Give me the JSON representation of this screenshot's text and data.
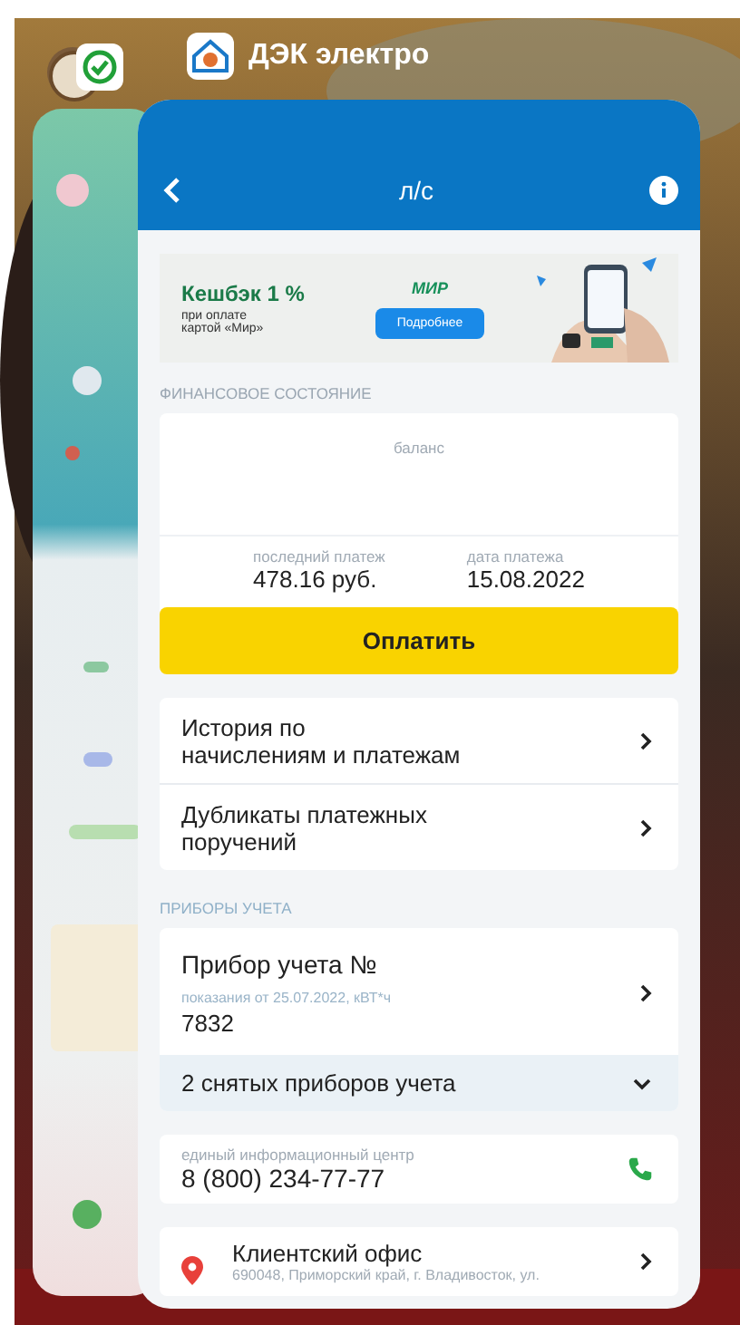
{
  "switcher": {
    "app_label": "ДЭК электро"
  },
  "app": {
    "nav": {
      "title": "л/с"
    },
    "banner": {
      "headline": "Кешбэк 1 %",
      "subtext": "при оплате\nкартой «Мир»",
      "logo_text": "МИР",
      "button": "Подробнее"
    },
    "finance": {
      "section_title": "ФИНАНСОВОЕ СОСТОЯНИЕ",
      "balance_label": "баланс",
      "last_payment_label": "последний платеж",
      "last_payment": "478.16 руб.",
      "date_label": "дата платежа",
      "date": "15.08.2022",
      "pay_button": "Оплатить"
    },
    "links": [
      {
        "label": "История по\nначислениям и платежам"
      },
      {
        "label": "Дубликаты платежных\nпоручений"
      }
    ],
    "meters": {
      "section_title": "ПРИБОРЫ УЧЕТА",
      "meter_title": "Прибор учета №",
      "reading_label": "показания от 25.07.2022, кВТ*ч",
      "reading": "7832",
      "removed": {
        "label": "2 снятых приборов учета",
        "expanded": false
      }
    },
    "contacts": [
      {
        "kind": "phone",
        "label": "единый информационный центр",
        "value": "8 (800) 234-77-77"
      },
      {
        "kind": "office",
        "label": "Клиентский офис",
        "value": "690048, Приморский край, г. Владивосток, ул."
      }
    ]
  }
}
